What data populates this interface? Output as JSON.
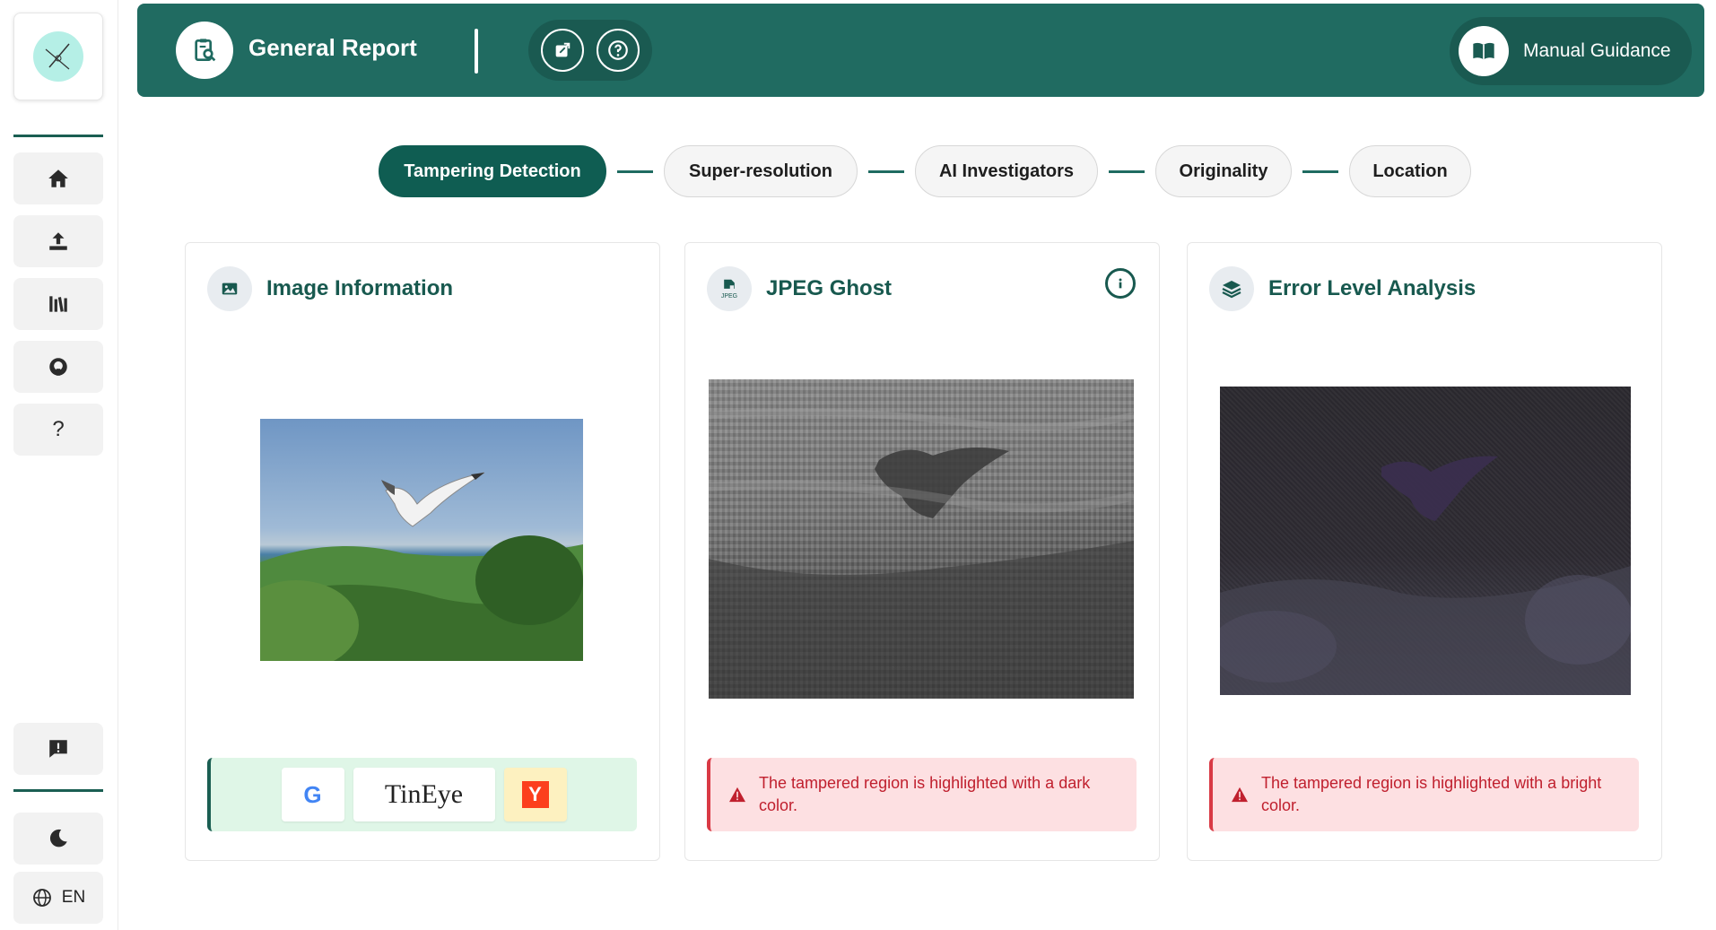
{
  "sidebar": {
    "items": [
      {
        "icon": "home-icon"
      },
      {
        "icon": "upload-icon"
      },
      {
        "icon": "library-icon"
      },
      {
        "icon": "github-icon"
      },
      {
        "icon": "question-icon",
        "glyph": "?"
      }
    ],
    "feedback_icon": "feedback-icon",
    "theme_icon": "moon-icon",
    "language": "EN"
  },
  "header": {
    "title": "General Report",
    "manual_label": "Manual Guidance",
    "bg_color": "#206b61"
  },
  "steps": [
    {
      "label": "Tampering Detection",
      "active": true
    },
    {
      "label": "Super-resolution",
      "active": false
    },
    {
      "label": "AI Investigators",
      "active": false
    },
    {
      "label": "Originality",
      "active": false
    },
    {
      "label": "Location",
      "active": false
    }
  ],
  "cards": {
    "image_info": {
      "title": "Image Information",
      "search_engines": [
        {
          "label": "G",
          "icon": "google-icon"
        },
        {
          "label": "TinEye",
          "icon": "tineye-icon"
        },
        {
          "label": "Y",
          "icon": "yandex-icon"
        }
      ]
    },
    "jpeg_ghost": {
      "title": "JPEG Ghost",
      "icon_text": "JPEG",
      "alert": "The tampered region is highlighted with a dark color."
    },
    "ela": {
      "title": "Error Level Analysis",
      "alert": "The tampered region is highlighted with a bright color."
    }
  }
}
